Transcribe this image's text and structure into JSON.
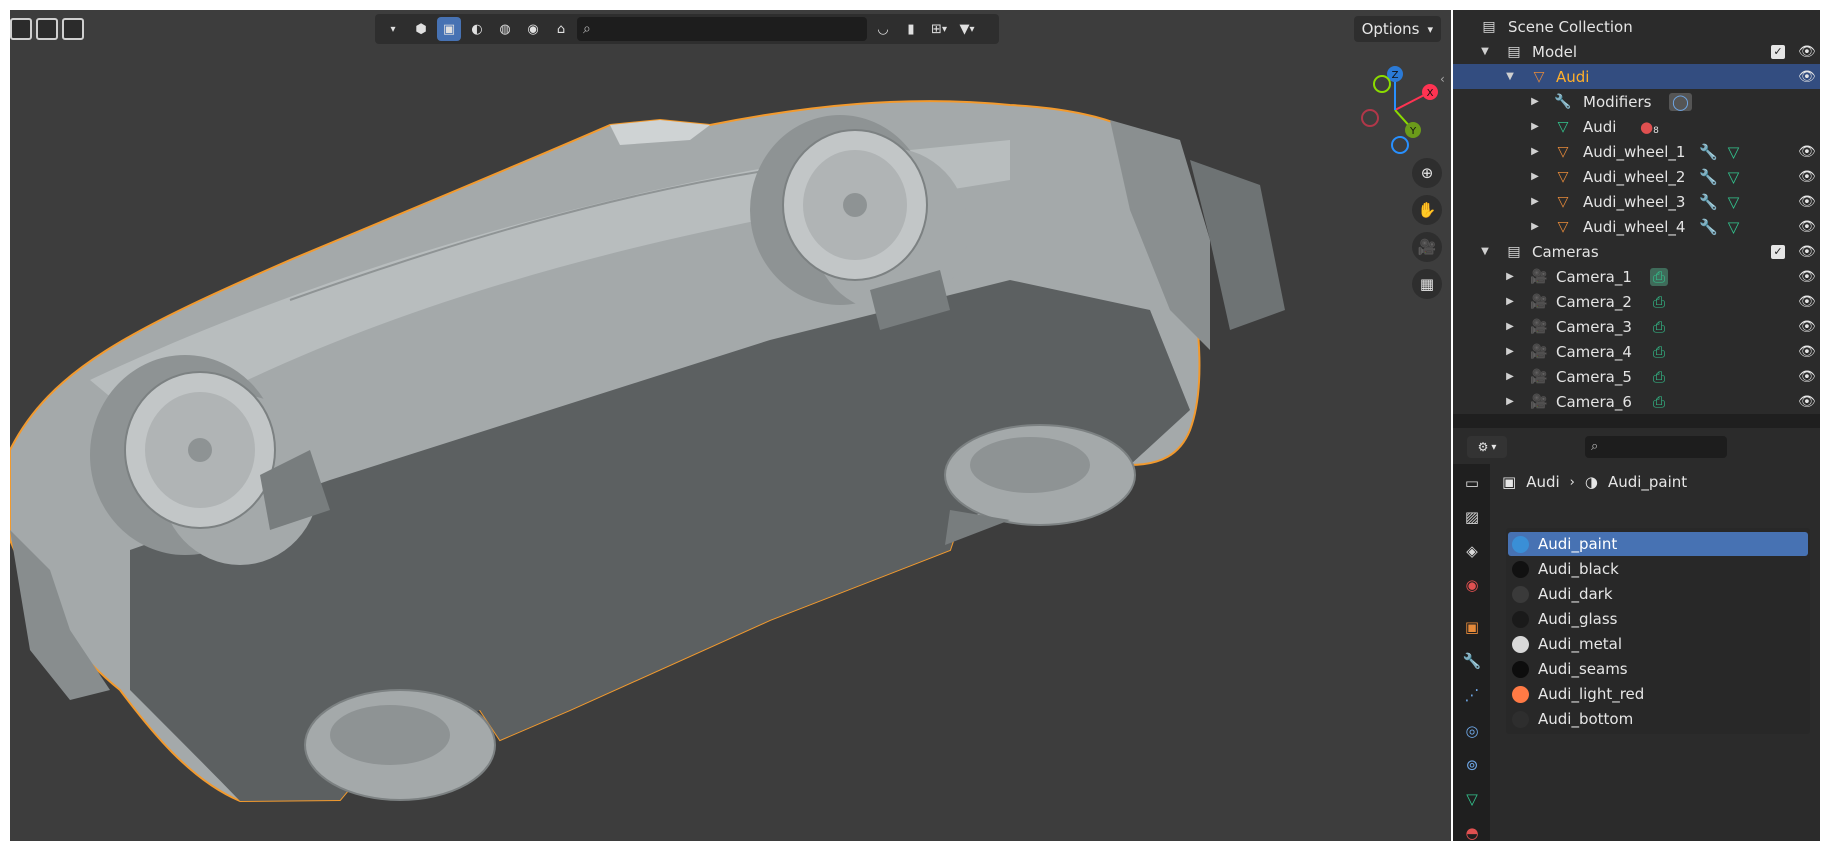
{
  "viewport": {
    "search_placeholder": "",
    "options_label": "Options",
    "gizmo": {
      "x_label": "X",
      "y_label": "Y",
      "z_label": "Z"
    },
    "header_icons": [
      "select-box-icon",
      "shading-solid-icon",
      "shading-material-icon",
      "shading-rendered-icon",
      "paint-icon",
      "search-icon",
      "overlay-icon",
      "bookmark-icon",
      "filter-icon"
    ],
    "nav_icons": [
      "zoom-icon",
      "pan-hand-icon",
      "camera-view-icon",
      "ortho-grid-icon"
    ]
  },
  "outliner": {
    "scene_collection": "Scene Collection",
    "rows": [
      {
        "label": "Model",
        "type": "collection"
      },
      {
        "label": "Audi",
        "type": "mesh-object"
      },
      {
        "label": "Modifiers",
        "type": "modifiers"
      },
      {
        "label": "Audi",
        "type": "mesh-data",
        "badge": "8"
      },
      {
        "label": "Audi_wheel_1",
        "type": "mesh-object"
      },
      {
        "label": "Audi_wheel_2",
        "type": "mesh-object"
      },
      {
        "label": "Audi_wheel_3",
        "type": "mesh-object"
      },
      {
        "label": "Audi_wheel_4",
        "type": "mesh-object"
      },
      {
        "label": "Cameras",
        "type": "collection"
      },
      {
        "label": "Camera_1",
        "type": "camera"
      },
      {
        "label": "Camera_2",
        "type": "camera"
      },
      {
        "label": "Camera_3",
        "type": "camera"
      },
      {
        "label": "Camera_4",
        "type": "camera"
      },
      {
        "label": "Camera_5",
        "type": "camera"
      },
      {
        "label": "Camera_6",
        "type": "camera"
      }
    ]
  },
  "properties": {
    "search_placeholder": "",
    "breadcrumb": {
      "object": "Audi",
      "material": "Audi_paint"
    },
    "material_slots": [
      {
        "name": "Audi_paint",
        "color": "#3a8fd6"
      },
      {
        "name": "Audi_black",
        "color": "#111111"
      },
      {
        "name": "Audi_dark",
        "color": "#3a3a3a"
      },
      {
        "name": "Audi_glass",
        "color": "#1a1a1a"
      },
      {
        "name": "Audi_metal",
        "color": "#d8d8d8"
      },
      {
        "name": "Audi_seams",
        "color": "#0d0d0d"
      },
      {
        "name": "Audi_light_red",
        "color": "#ff7a45"
      },
      {
        "name": "Audi_bottom",
        "color": "#2e2e2e"
      }
    ],
    "tabs": [
      "tool-icon",
      "render-icon",
      "output-icon",
      "view-layer-icon",
      "scene-icon",
      "world-icon",
      "object-icon",
      "modifier-icon",
      "particles-icon",
      "physics-icon",
      "constraints-icon",
      "data-icon",
      "material-icon"
    ]
  },
  "colors": {
    "selection_orange": "#ffaf29",
    "selection_blue": "#4772b3",
    "outline_orange": "#f29a2e"
  }
}
